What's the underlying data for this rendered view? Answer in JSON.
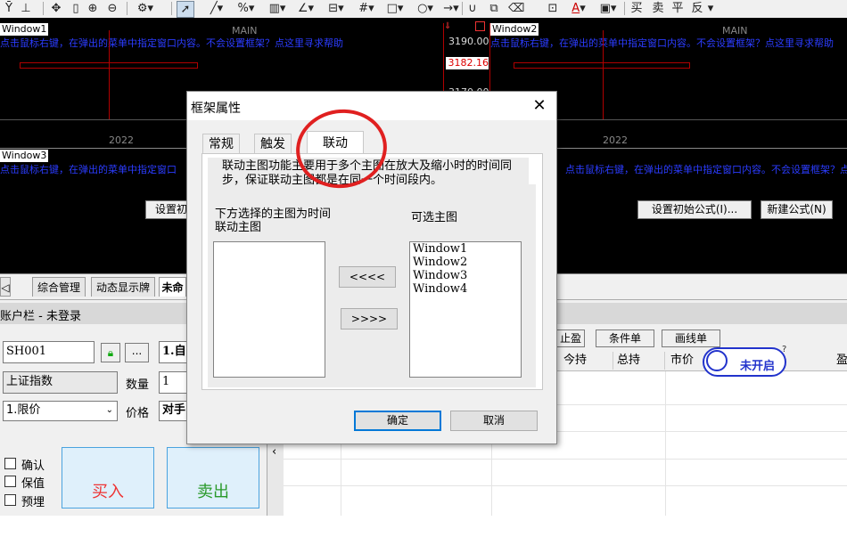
{
  "toolbar": {
    "icons": [
      "formula-icon",
      "percent-icon",
      "move-icon",
      "bar-icon",
      "zoom-in-icon",
      "zoom-out-icon",
      "gear-icon",
      "pointer-icon",
      "line-icon",
      "percent-tool-icon",
      "fib-icon",
      "draw-icon",
      "parallel-icon",
      "grid-icon",
      "rect-icon",
      "circle-icon",
      "arrow-icon",
      "magnet-icon",
      "copy-icon",
      "delete-icon",
      "lock-icon",
      "text-icon",
      "save-icon"
    ],
    "buy_label": "买",
    "sell_label": "卖",
    "flat_label": "平",
    "reverse_label": "反"
  },
  "charts": {
    "win1_title": "Window1",
    "win2_title": "Window2",
    "win3_title": "Window3",
    "main_label_1": "MAIN",
    "main_label_2": "MAIN",
    "hint_text": "点击鼠标右键，在弹出的菜单中指定窗口内容。不会设置框架？点这里寻求帮助",
    "hint_text_3": "点击鼠标右键，在弹出的菜单中指定窗口",
    "hint_text_4": "点击鼠标右键，在弹出的菜单中指定窗口内容。不会设置框架？点这里寻求",
    "price_top": "3190.00",
    "price_current": "3182.16",
    "price_low": "3170.00",
    "year_left": "2022",
    "year_right": "2022",
    "set_init_left": "设置初",
    "set_init_right": "设置初始公式(I)...",
    "new_formula": "新建公式(N)"
  },
  "bottom": {
    "tabs": [
      "综合管理",
      "动态显示牌",
      "未命"
    ],
    "account_bar": "账户栏 - 未登录",
    "account_code": "SH001",
    "more_btn": "...",
    "mode_value": "1.自",
    "instrument": "上证指数",
    "qty_label": "数量",
    "qty_value": "1",
    "order_type": "1.限价",
    "price_label": "价格",
    "price_value": "对手",
    "confirm_label": "确认",
    "hold_label": "保值",
    "preorder_label": "预埋",
    "buy_in": "买入",
    "sell_out": "卖出",
    "stop_profit": "止盈",
    "conditional": "条件单",
    "line_order": "画线单",
    "columns": [
      "今持",
      "总持",
      "市价",
      "盈"
    ],
    "status_badge": "未开启",
    "badge_help": "?"
  },
  "dialog": {
    "title": "框架属性",
    "close": "✕",
    "tabs": [
      "常规",
      "触发",
      "联动"
    ],
    "active_tab": "联动",
    "description": "联动主图功能主要用于多个主图在放大及缩小时的时间同步，保证联动主图都是在同一个时间段内。",
    "left_label": "下方选择的主图为时间联动主图",
    "right_label": "可选主图",
    "move_left": "<<<<",
    "move_right": ">>>>",
    "available": [
      "Window1",
      "Window2",
      "Window3",
      "Window4"
    ],
    "ok": "确定",
    "cancel": "取消"
  },
  "annotation": {
    "circle_color": "#e02020"
  }
}
